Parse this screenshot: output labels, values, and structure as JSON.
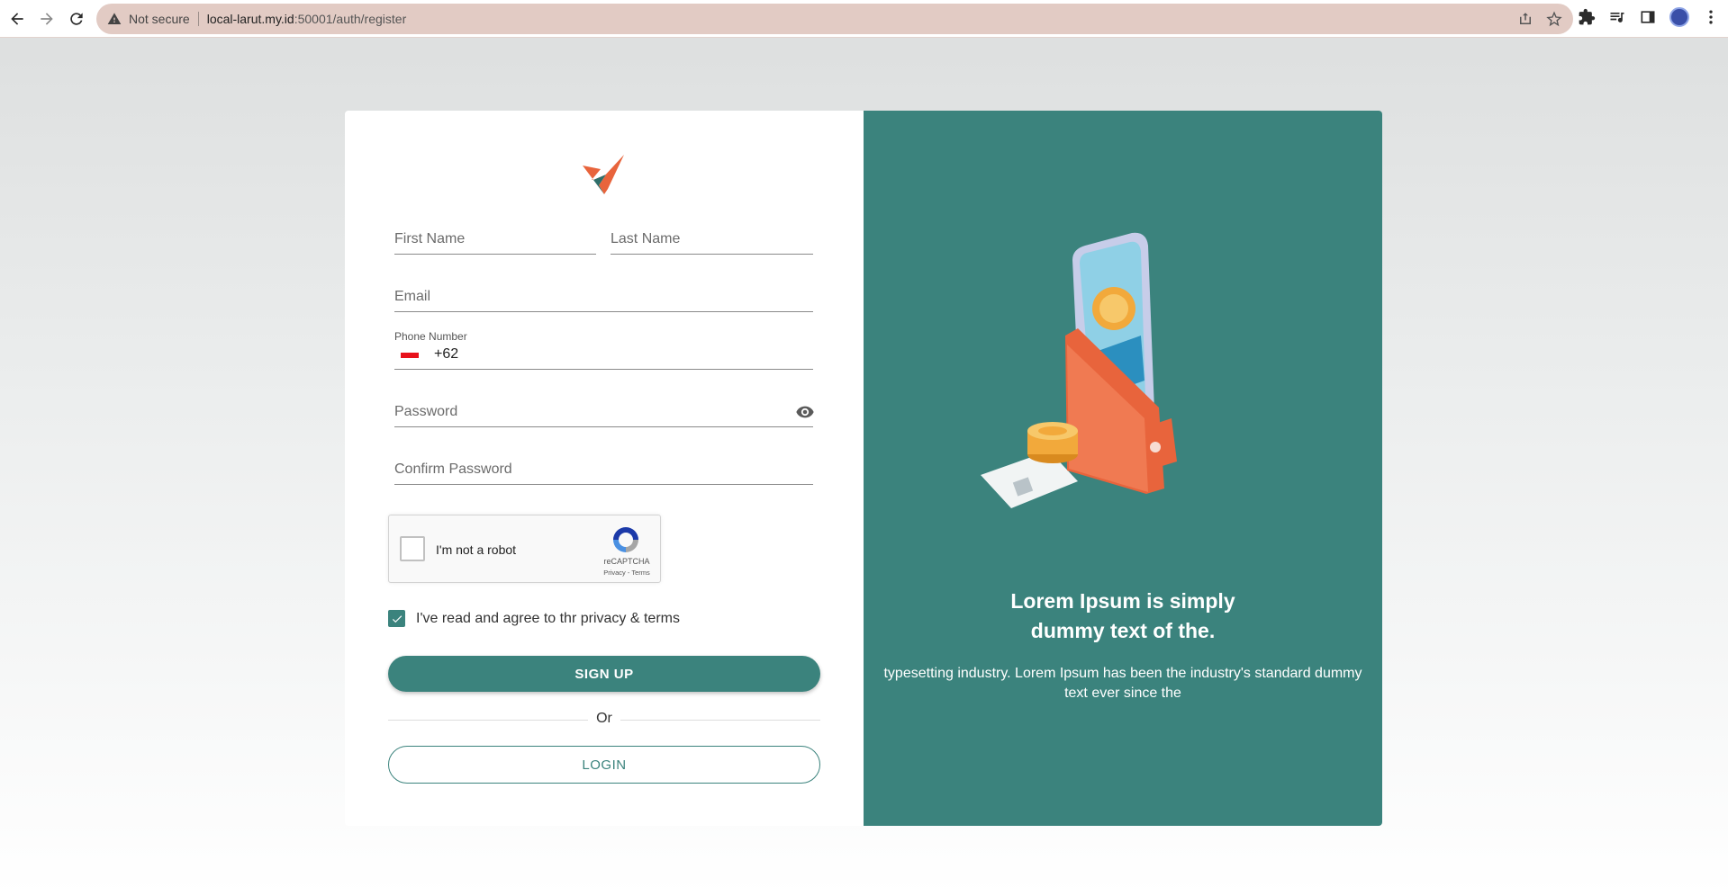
{
  "browser": {
    "security_label": "Not secure",
    "url_host": "local-larut.my.id",
    "url_path": ":50001/auth/register",
    "icons": [
      "back-icon",
      "forward-icon",
      "reload-icon",
      "warning-icon",
      "share-icon",
      "star-icon",
      "extensions-icon",
      "media-icon",
      "sidebar-icon",
      "profile-avatar",
      "menu-icon"
    ]
  },
  "form": {
    "first_name_placeholder": "First Name",
    "last_name_placeholder": "Last Name",
    "email_placeholder": "Email",
    "phone_label": "Phone Number",
    "phone_prefix": "+62",
    "password_placeholder": "Password",
    "confirm_password_placeholder": "Confirm Password",
    "captcha_text": "I'm not a robot",
    "captcha_brand": "reCAPTCHA",
    "captcha_links": "Privacy - Terms",
    "agree_text": "I've read and agree to thr privacy & terms",
    "agree_checked": true,
    "signup_label": "SIGN UP",
    "or_label": "Or",
    "login_label": "LOGIN"
  },
  "promo": {
    "headline_line1": "Lorem Ipsum is simply",
    "headline_line2": "dummy text of the.",
    "subtext": "typesetting industry. Lorem Ipsum has been the industry's standard dummy text ever since the"
  },
  "colors": {
    "accent": "#3b837d",
    "brand_orange": "#e8643c",
    "omnibox": "#e2cbc4"
  }
}
